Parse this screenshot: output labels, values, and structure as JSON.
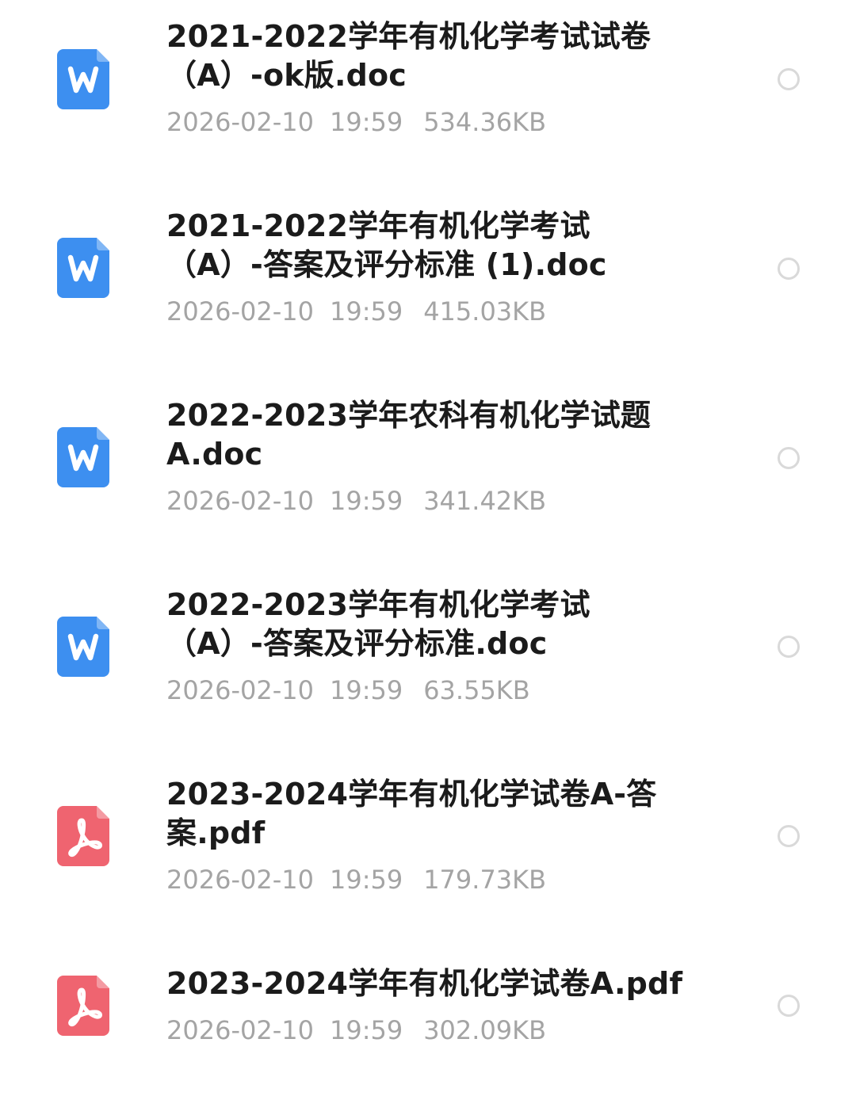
{
  "colors": {
    "doc_icon": "#3d8ff0",
    "pdf_icon": "#ef6470",
    "name_text": "#1b1b1b",
    "meta_text": "#a4a4a4",
    "radio_border": "#d9d9d9"
  },
  "files": [
    {
      "icon": "word-doc-icon",
      "type": "doc",
      "name": "2021-2022学年有机化学考试试卷\n（A）-ok版.doc",
      "date": "2026-02-10",
      "time": "19:59",
      "size": "534.36KB",
      "selected": false
    },
    {
      "icon": "word-doc-icon",
      "type": "doc",
      "name": "2021-2022学年有机化学考试\n（A）-答案及评分标准 (1).doc",
      "date": "2026-02-10",
      "time": "19:59",
      "size": "415.03KB",
      "selected": false
    },
    {
      "icon": "word-doc-icon",
      "type": "doc",
      "name": "2022-2023学年农科有机化学试题\nA.doc",
      "date": "2026-02-10",
      "time": "19:59",
      "size": "341.42KB",
      "selected": false
    },
    {
      "icon": "word-doc-icon",
      "type": "doc",
      "name": "2022-2023学年有机化学考试\n（A）-答案及评分标准.doc",
      "date": "2026-02-10",
      "time": "19:59",
      "size": "63.55KB",
      "selected": false
    },
    {
      "icon": "pdf-icon",
      "type": "pdf",
      "name": "2023-2024学年有机化学试卷A-答\n案.pdf",
      "date": "2026-02-10",
      "time": "19:59",
      "size": "179.73KB",
      "selected": false
    },
    {
      "icon": "pdf-icon",
      "type": "pdf",
      "name": "2023-2024学年有机化学试卷A.pdf",
      "date": "2026-02-10",
      "time": "19:59",
      "size": "302.09KB",
      "selected": false
    }
  ]
}
